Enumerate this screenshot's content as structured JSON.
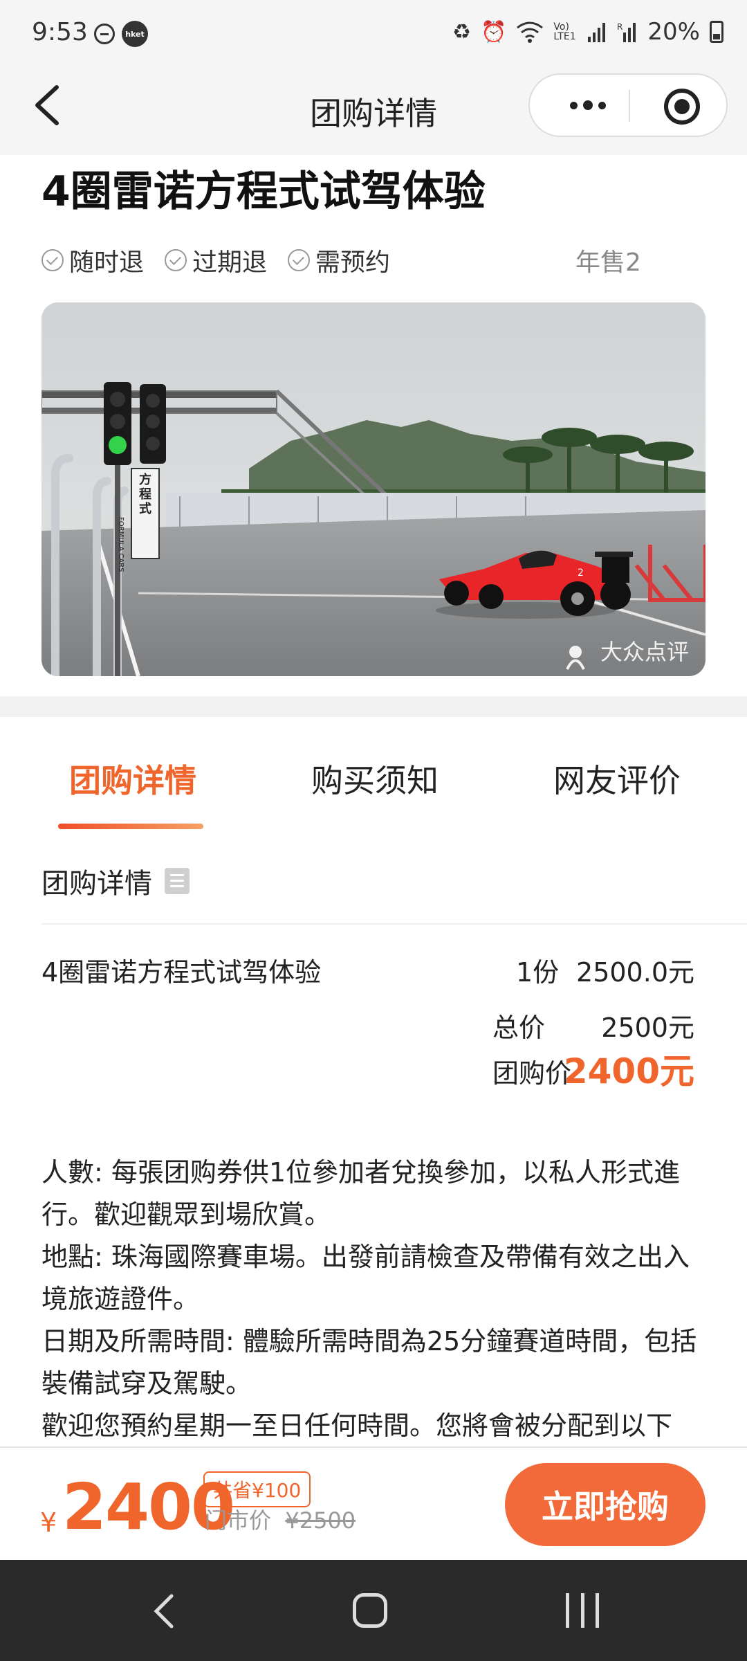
{
  "status_bar": {
    "time": "9:53",
    "hket": "hket",
    "volte": "Vo) LTE1",
    "battery": "20%",
    "icons": [
      "minus-circle-icon",
      "hket-icon",
      "recycle-icon",
      "alarm-icon",
      "wifi-icon",
      "volte-icon",
      "signal-icon",
      "signal-r-icon",
      "battery-icon"
    ]
  },
  "nav": {
    "title": "团购详情",
    "icons": [
      "back-arrow-icon",
      "more-dots-icon",
      "target-icon"
    ]
  },
  "product": {
    "title": "4圈雷诺方程式试驾体验",
    "tags": [
      "随时退",
      "过期退",
      "需预约"
    ],
    "annual_sales": "年售2",
    "photo": {
      "sign_text_cn": "方程式",
      "sign_text_en": "FORMULA CARS",
      "watermark": "大众点评"
    }
  },
  "tabs": {
    "items": [
      "团购详情",
      "购买须知",
      "网友评价"
    ],
    "active_index": 0,
    "active_color": "#f0652b"
  },
  "details": {
    "section_title": "团购详情",
    "item_name": "4圈雷诺方程式试驾体验",
    "item_qty": "1份",
    "item_price": "2500.0元",
    "total_label": "总价",
    "total_value": "2500元",
    "group_label": "团购价",
    "group_value": "2400元",
    "description": [
      "人數: 每張团购券供1位參加者兌換參加，以私人形式進行。歡迎觀眾到場欣賞。",
      "地點: 珠海國際賽車場。出發前請檢查及帶備有效之出入境旅遊證件。",
      "日期及所需時間: 體驗所需時間為25分鐘賽道時間，包括裝備試穿及駕駛。",
      "歡迎您預約星期一至日任何時間。您將會被分配到以下"
    ]
  },
  "bottom": {
    "yen": "¥",
    "price": "2400",
    "save_badge": "共省¥100",
    "market_label": "门市价",
    "market_price": "¥2500",
    "buy_button": "立即抢购",
    "accent_color": "#f0652b"
  },
  "system_nav": {
    "icons": [
      "back-icon",
      "home-icon",
      "recent-apps-icon"
    ]
  }
}
